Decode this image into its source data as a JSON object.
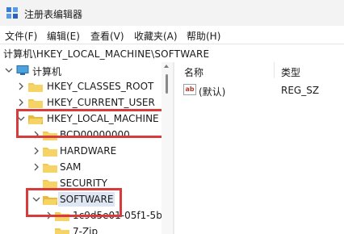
{
  "window": {
    "title": "注册表编辑器",
    "app_icon": "registry-editor-icon"
  },
  "menu": [
    "文件(F)",
    "编辑(E)",
    "查看(V)",
    "收藏夹(A)",
    "帮助(H)"
  ],
  "address_bar": {
    "path": "计算机\\HKEY_LOCAL_MACHINE\\SOFTWARE"
  },
  "tree": {
    "root_label": "计算机",
    "hives": [
      {
        "label": "HKEY_CLASSES_ROOT",
        "expanded": false
      },
      {
        "label": "HKEY_CURRENT_USER",
        "expanded": false
      },
      {
        "label": "HKEY_LOCAL_MACHINE",
        "expanded": true,
        "highlighted": true
      }
    ],
    "hklm_children": [
      {
        "label": "BCD00000000",
        "expanded": false
      },
      {
        "label": "HARDWARE",
        "expanded": false
      },
      {
        "label": "SAM",
        "expanded": false
      },
      {
        "label": "SECURITY",
        "expanded": false
      },
      {
        "label": "SOFTWARE",
        "expanded": true,
        "selected": true,
        "highlighted": true
      }
    ],
    "software_children": [
      {
        "label": "1c9d5e01-05f1-5b"
      },
      {
        "label": "7-Zip"
      }
    ]
  },
  "list": {
    "columns": [
      "名称",
      "类型"
    ],
    "rows": [
      {
        "icon": "string-value-icon",
        "name": "(默认)",
        "type": "REG_SZ"
      }
    ]
  },
  "colors": {
    "highlight_box": "#d83b3b",
    "folder": "#f2c94c",
    "selection": "#dde6f2"
  }
}
